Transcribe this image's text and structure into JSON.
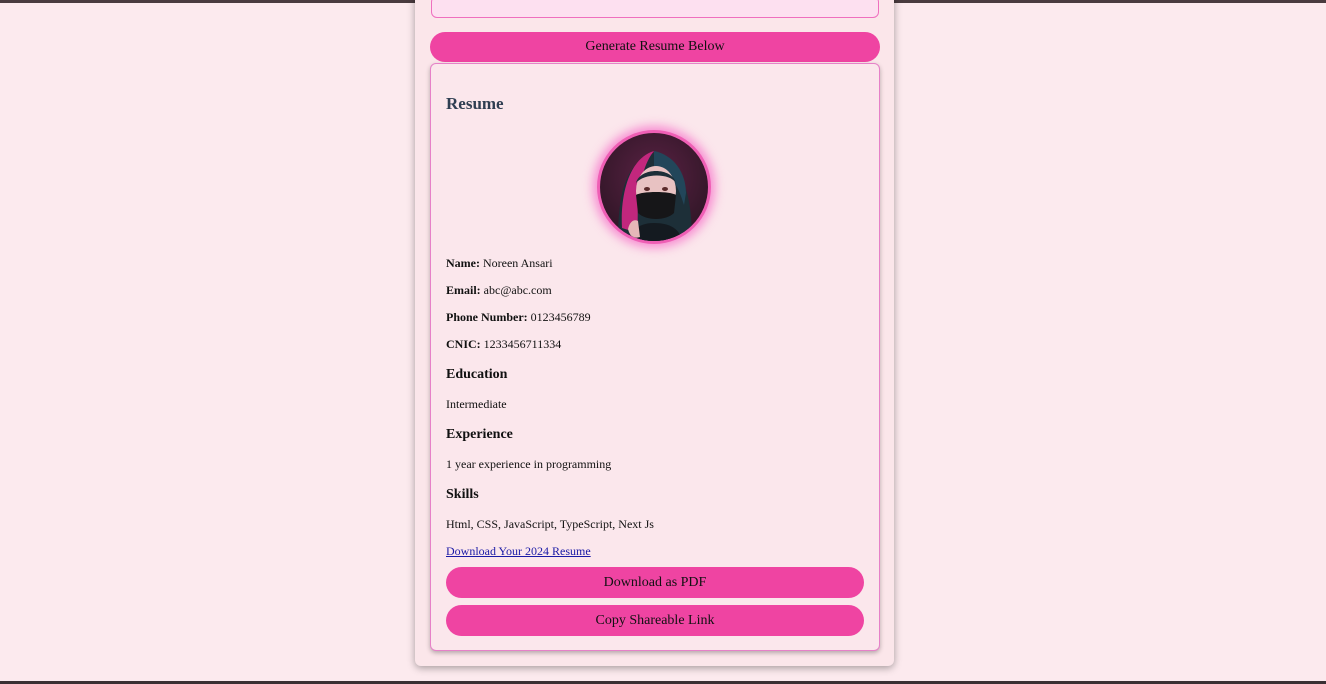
{
  "actions": {
    "generate_label": "Generate Resume Below"
  },
  "resume": {
    "title": "Resume",
    "fields": [
      {
        "label": "Name:",
        "value": " Noreen Ansari"
      },
      {
        "label": "Email:",
        "value": " abc@abc.com"
      },
      {
        "label": "Phone Number:",
        "value": " 0123456789"
      },
      {
        "label": "CNIC:",
        "value": " 1233456711334"
      }
    ],
    "education": {
      "heading": "Education",
      "text": "Intermediate"
    },
    "experience": {
      "heading": "Experience",
      "text": "1 year experience in programming"
    },
    "skills": {
      "heading": "Skills",
      "text": "Html, CSS, JavaScript, TypeScript, Next Js"
    },
    "download_link": "Download Your 2024 Resume",
    "pdf_button": "Download as PDF",
    "share_button": "Copy Shareable Link"
  },
  "colors": {
    "page_bg": "#fceaee",
    "accent": "#ef44a2",
    "panel_border": "#e681c8",
    "title": "#2f3e52",
    "link": "#1a1aa6"
  },
  "icons": {
    "profile": "profile-photo"
  }
}
